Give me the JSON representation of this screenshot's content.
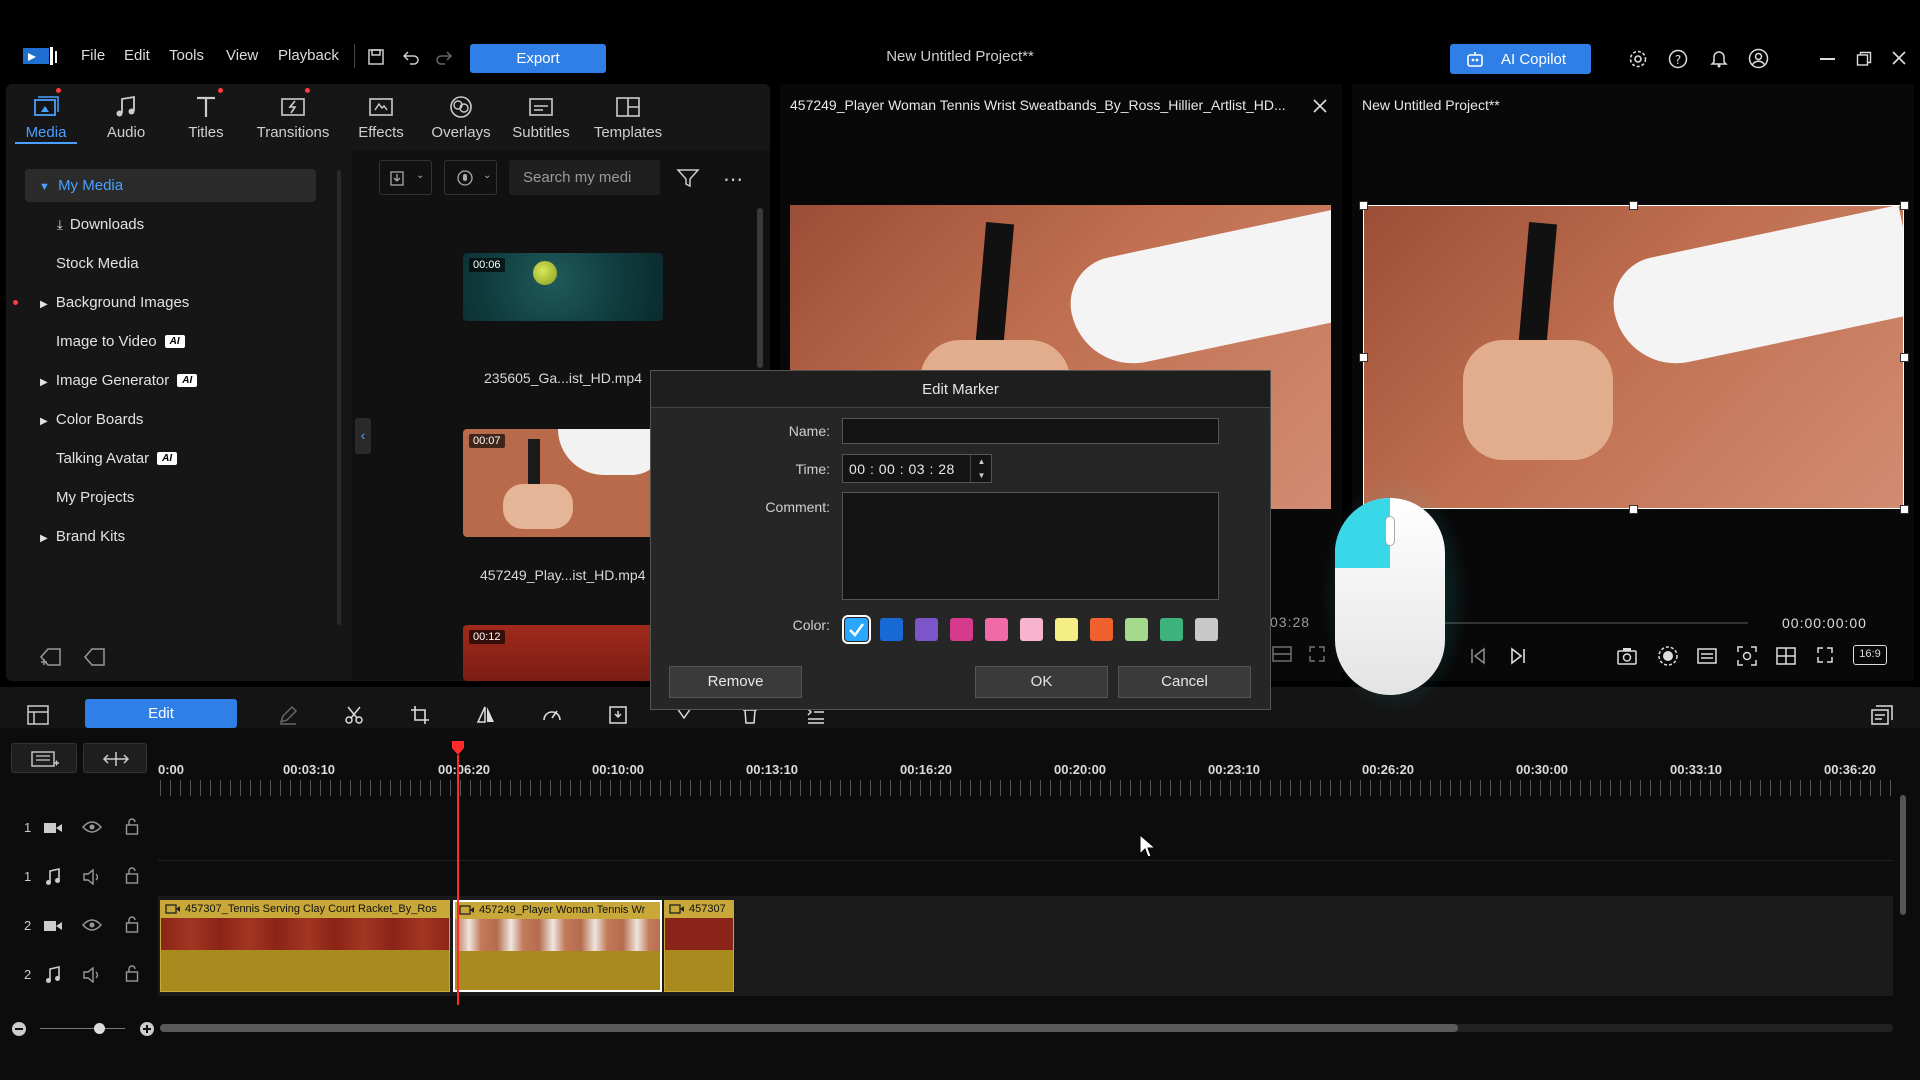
{
  "menubar": {
    "items": [
      "File",
      "Edit",
      "Tools",
      "View",
      "Playback"
    ],
    "export_label": "Export",
    "project_title": "New Untitled Project**",
    "copilot_label": "AI Copilot"
  },
  "tabs": [
    {
      "label": "Media",
      "icon": "media-icon"
    },
    {
      "label": "Audio",
      "icon": "audio-icon"
    },
    {
      "label": "Titles",
      "icon": "titles-icon"
    },
    {
      "label": "Transitions",
      "icon": "transitions-icon"
    },
    {
      "label": "Effects",
      "icon": "effects-icon"
    },
    {
      "label": "Overlays",
      "icon": "overlays-icon"
    },
    {
      "label": "Subtitles",
      "icon": "subtitles-icon"
    },
    {
      "label": "Templates",
      "icon": "templates-icon"
    }
  ],
  "library_tree": {
    "items": [
      {
        "label": "My Media",
        "selected": true,
        "expanded": true
      },
      {
        "label": "Downloads"
      },
      {
        "label": "Stock Media"
      },
      {
        "label": "Background Images"
      },
      {
        "label": "Image to Video",
        "badge": "AI"
      },
      {
        "label": "Image Generator",
        "badge": "AI"
      },
      {
        "label": "Color Boards"
      },
      {
        "label": "Talking Avatar",
        "badge": "AI"
      },
      {
        "label": "My Projects"
      },
      {
        "label": "Brand Kits"
      }
    ]
  },
  "media": {
    "search_placeholder": "Search my medi",
    "clips": [
      {
        "duration": "00:06",
        "name": "235605_Ga...ist_HD.mp4"
      },
      {
        "duration": "00:07",
        "name": "457249_Play...ist_HD.mp4"
      },
      {
        "duration": "00:12",
        "name": ""
      }
    ]
  },
  "source_preview": {
    "title": "457249_Player Woman Tennis Wrist Sweatbands_By_Ross_Hillier_Artlist_HD...",
    "timecode_partial": "03:28"
  },
  "program_preview": {
    "title": "New Untitled Project**",
    "timecode": "00:00:00:00",
    "aspect": "16:9"
  },
  "edit_marker_dialog": {
    "title": "Edit Marker",
    "name_label": "Name:",
    "name_value": "",
    "time_label": "Time:",
    "time_value": "00 : 00 : 03 : 28",
    "comment_label": "Comment:",
    "comment_value": "",
    "color_label": "Color:",
    "colors": [
      "#2aa8ff",
      "#1769d6",
      "#7b55c9",
      "#d63a8c",
      "#f06aa8",
      "#f7b4cf",
      "#f5ee84",
      "#f0612e",
      "#a3d98c",
      "#3bb37a",
      "#c8c8c8"
    ],
    "selected_color_index": 0,
    "remove_label": "Remove",
    "ok_label": "OK",
    "cancel_label": "Cancel"
  },
  "timeline": {
    "edit_label": "Edit",
    "ruler": [
      "0:00",
      "00:03:10",
      "00:06:20",
      "00:10:00",
      "00:13:10",
      "00:16:20",
      "00:20:00",
      "00:23:10",
      "00:26:20",
      "00:30:00",
      "00:33:10",
      "00:36:20"
    ],
    "tracks": [
      {
        "number": "1",
        "type": "video"
      },
      {
        "number": "1",
        "type": "audio"
      },
      {
        "number": "2",
        "type": "video"
      },
      {
        "number": "2",
        "type": "audio"
      }
    ],
    "clips": [
      {
        "label": "457307_Tennis Serving Clay Court Racket_By_Ros"
      },
      {
        "label": "457249_Player Woman Tennis Wr"
      },
      {
        "label": "457307"
      }
    ]
  }
}
